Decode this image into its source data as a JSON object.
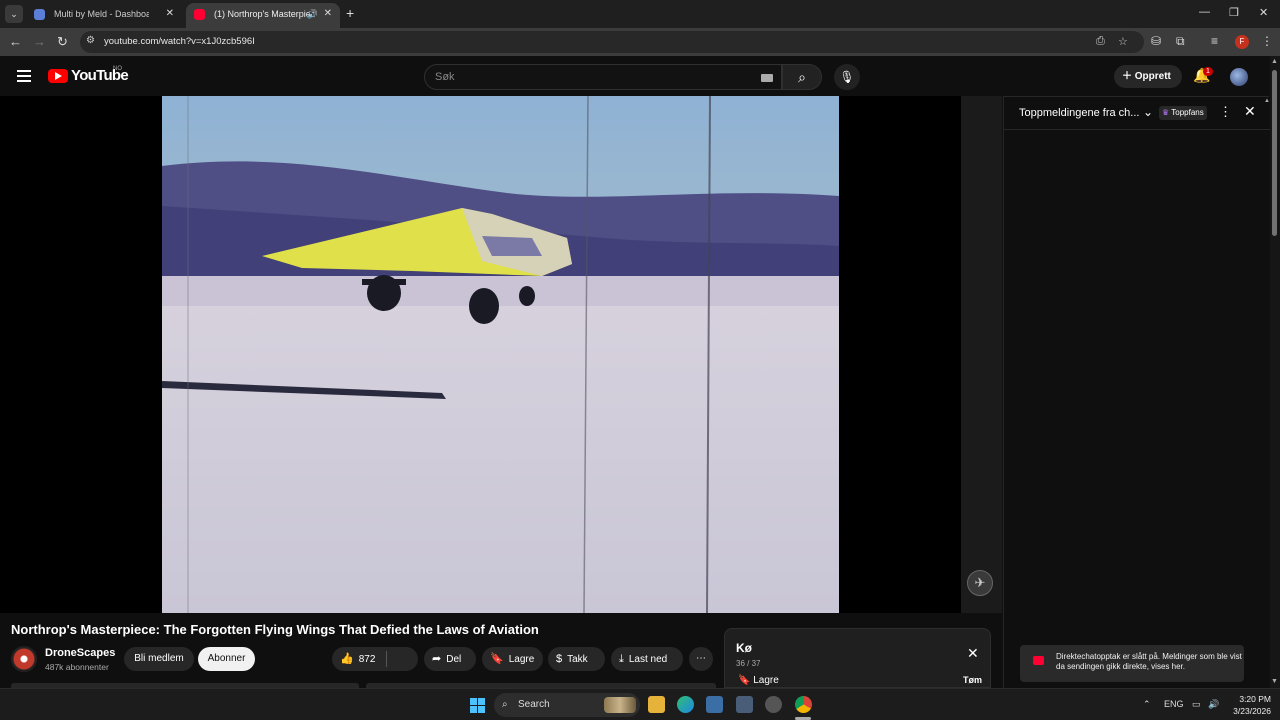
{
  "browser": {
    "tabs": [
      {
        "title": "Multi by Meld - Dashboard.",
        "active": false
      },
      {
        "title": "(1) Northrop's Masterpiece",
        "active": true
      }
    ],
    "url": "youtube.com/watch?v=x1J0zcb596I"
  },
  "youtube": {
    "logo_text": "YouTube",
    "region": "NO",
    "search_placeholder": "Søk",
    "create_label": "Opprett",
    "notification_count": "1"
  },
  "video": {
    "title": "Northrop's Masterpiece: The Forgotten Flying Wings That Defied the Laws of Aviation",
    "channel": "DroneScapes",
    "subscribers": "487k abonnenter",
    "member_label": "Bli medlem",
    "subscribe_label": "Abonner",
    "likes": "872",
    "share_label": "Del",
    "save_label": "Lagre",
    "thanks_label": "Takk",
    "download_label": "Last ned"
  },
  "chat": {
    "title": "Toppmeldingene fra ch...",
    "badge": "Toppfans",
    "notice": "Direktechatopptak er slått på. Meldinger som ble vist da sendingen gikk direkte, vises her."
  },
  "queue": {
    "title": "Kø",
    "count": "36 / 37",
    "save_label": "Lagre",
    "clear_label": "Tøm"
  },
  "taskbar": {
    "search_label": "Search",
    "language": "ENG",
    "time": "3:20 PM",
    "date": "3/23/2026"
  },
  "colors": {
    "accent": "#ff0000",
    "background": "#0f0f0f",
    "surface": "#272727"
  }
}
